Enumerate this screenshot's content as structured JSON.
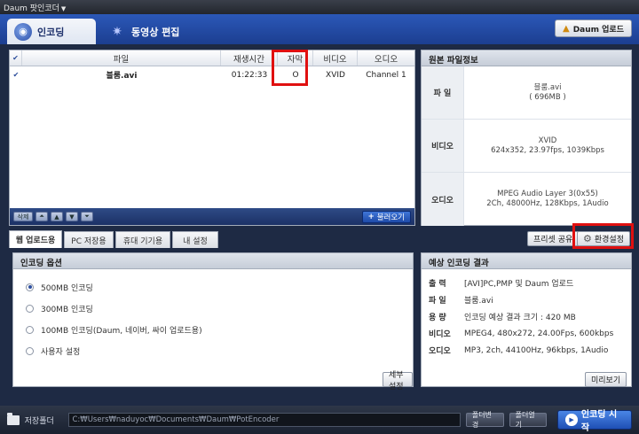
{
  "app": {
    "title": "Daum 팟인코더"
  },
  "main_tabs": [
    {
      "label": "인코딩",
      "active": true
    },
    {
      "label": "동영상 편집",
      "active": false
    }
  ],
  "upload_button": {
    "label": "Daum 업로드"
  },
  "file_list": {
    "columns": [
      "파일",
      "재생시간",
      "자막",
      "비디오",
      "오디오"
    ],
    "rows": [
      {
        "checked": true,
        "file": "블룸.avi",
        "duration": "01:22:33",
        "subtitle": "O",
        "video": "XVID",
        "audio": "Channel 1"
      }
    ],
    "footer": {
      "delete_label": "삭제",
      "open_label": "불러오기"
    }
  },
  "source_info": {
    "title": "원본 파일정보",
    "rows": [
      {
        "label": "파 일",
        "line1": "블룸.avi",
        "line2": "( 696MB )"
      },
      {
        "label": "비디오",
        "line1": "XVID",
        "line2": "624x352, 23.97fps, 1039Kbps"
      },
      {
        "label": "오디오",
        "line1": "MPEG Audio Layer 3(0x55)",
        "line2": "2Ch, 48000Hz, 128Kbps, 1Audio"
      }
    ]
  },
  "sub_tabs": [
    {
      "label": "웹 업로드용",
      "active": true
    },
    {
      "label": "PC 저장용",
      "active": false
    },
    {
      "label": "휴대 기기용",
      "active": false
    },
    {
      "label": "내 설정",
      "active": false
    }
  ],
  "preset_share": {
    "label": "프리셋 공유"
  },
  "settings_button": {
    "label": "환경설정"
  },
  "encoding_options": {
    "title": "인코딩 옵션",
    "options": [
      {
        "label": "500MB 인코딩",
        "selected": true
      },
      {
        "label": "300MB 인코딩",
        "selected": false
      },
      {
        "label": "100MB 인코딩(Daum, 네이버, 싸이 업로드용)",
        "selected": false
      },
      {
        "label": "사용자 설정",
        "selected": false
      }
    ],
    "detail_button": "세부설정"
  },
  "expected_result": {
    "title": "예상 인코딩 결과",
    "rows": [
      {
        "label": "출  력",
        "value": "[AVI]PC,PMP 및 Daum 업로드"
      },
      {
        "label": "파  일",
        "value": "블룸.avi"
      },
      {
        "label": "용  량",
        "value": "인코딩 예상 결과 크기 : 420 MB"
      },
      {
        "label": "비디오",
        "value": "MPEG4, 480x272, 24.00Fps, 600kbps"
      },
      {
        "label": "오디오",
        "value": "MP3, 2ch, 44100Hz, 96kbps, 1Audio"
      }
    ],
    "preview_button": "미리보기"
  },
  "bottom": {
    "save_folder_label": "저장폴더",
    "path": "C:₩Users₩naduyoc₩Documents₩Daum₩PotEncoder",
    "change_folder": "폴더변경",
    "open_folder": "폴더열기",
    "start": "인코딩 시작"
  },
  "colors": {
    "highlight": "#e01010",
    "accent": "#2b58b8"
  }
}
